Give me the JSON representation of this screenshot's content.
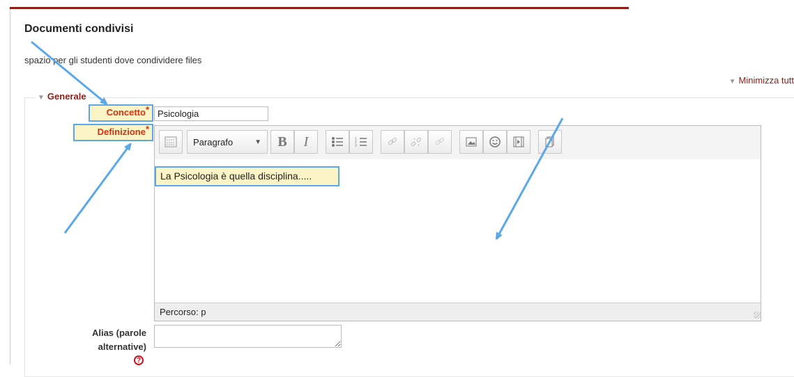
{
  "section": {
    "title": "Documenti condivisi",
    "description": "spazio per gli studenti dove condividere files",
    "collapse_all": "Minimizza tutt"
  },
  "form": {
    "legend": "Generale",
    "concept": {
      "label": "Concetto",
      "required_marker": "*",
      "value": "Psicologia"
    },
    "definition": {
      "label": "Definizione",
      "required_marker": "*",
      "text": "La Psicologia è quella disciplina.....",
      "path": "Percorso: p"
    },
    "alias": {
      "label_line1": "Alias (parole",
      "label_line2": "alternative)",
      "value": "",
      "help_icon": "?"
    }
  },
  "editor_toolbar": {
    "format_select": "Paragrafo",
    "buttons": [
      "toolbar-toggle",
      "bold",
      "italic",
      "unordered-list",
      "ordered-list",
      "link",
      "unlink",
      "link-file",
      "image",
      "emoticon",
      "media",
      "file"
    ],
    "bold_glyph": "B",
    "italic_glyph": "I"
  },
  "annotation_color": "#5aa8ea",
  "accent_color": "#8e1c17"
}
